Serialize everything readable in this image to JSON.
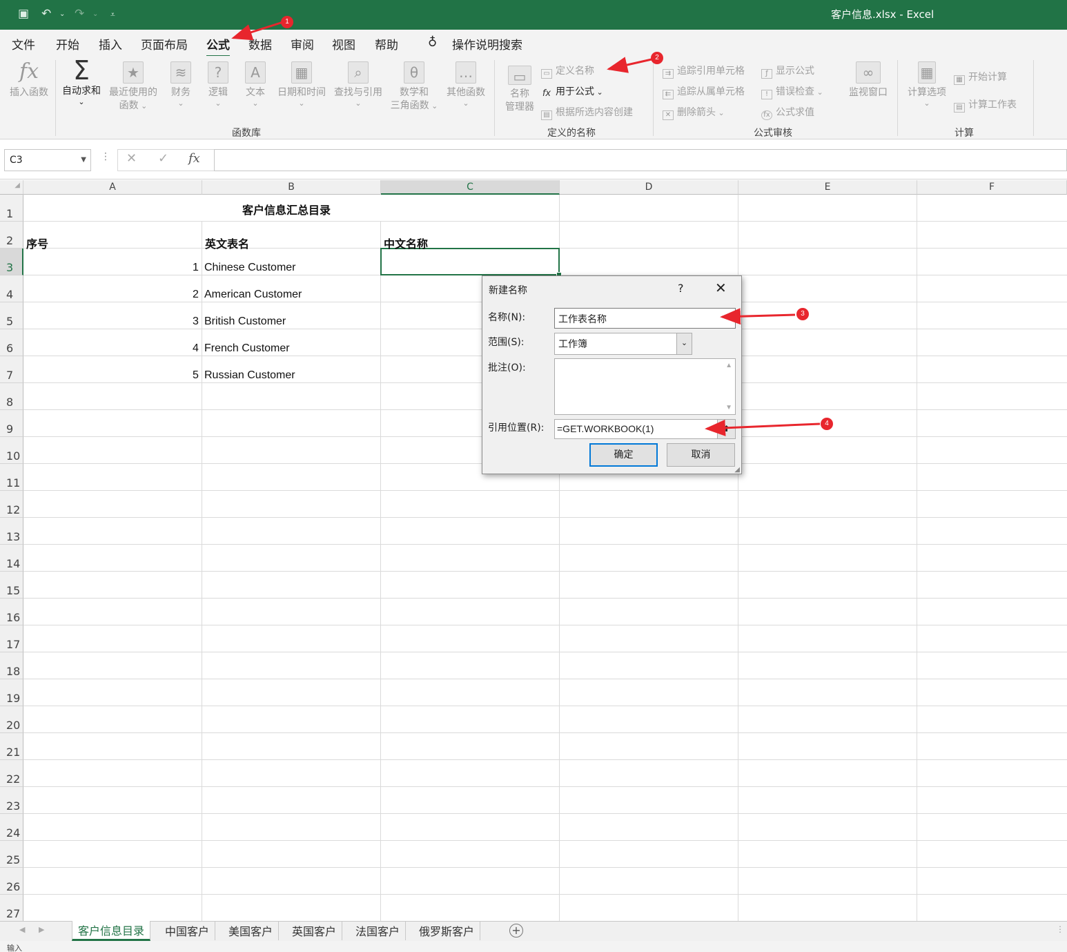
{
  "titlebar": {
    "title": "客户信息.xlsx  -  Excel"
  },
  "menu": [
    "文件",
    "开始",
    "插入",
    "页面布局",
    "公式",
    "数据",
    "审阅",
    "视图",
    "帮助"
  ],
  "tellme": "操作说明搜索",
  "ribbon": {
    "insert_function": "插入函数",
    "autosum": "自动求和",
    "recent": [
      "最近使用的",
      "函数"
    ],
    "financial": "财务",
    "logical": "逻辑",
    "text": "文本",
    "datetime": "日期和时间",
    "lookup": "查找与引用",
    "math": [
      "数学和",
      "三角函数"
    ],
    "more": "其他函数",
    "group_library": "函数库",
    "name_manager": [
      "名称",
      "管理器"
    ],
    "define_name": "定义名称",
    "use_in_formula": "用于公式",
    "create_from_selection": "根据所选内容创建",
    "group_defined_names": "定义的名称",
    "trace_precedents": "追踪引用单元格",
    "trace_dependents": "追踪从属单元格",
    "remove_arrows": "删除箭头",
    "show_formulas": "显示公式",
    "error_checking": "错误检查",
    "evaluate_formula": "公式求值",
    "watch_window": "监视窗口",
    "group_auditing": "公式审核",
    "calc_options": "计算选项",
    "calc_now": "开始计算",
    "calc_sheet": "计算工作表",
    "group_calc": "计算"
  },
  "formula_bar": {
    "name_box": "C3",
    "formula": ""
  },
  "columns": [
    "A",
    "B",
    "C",
    "D",
    "E",
    "F"
  ],
  "rows": [
    "1",
    "2",
    "3",
    "4",
    "5",
    "6",
    "7",
    "8",
    "9",
    "10",
    "11",
    "12",
    "13",
    "14",
    "15",
    "16",
    "17",
    "18",
    "19",
    "20",
    "21",
    "22",
    "23",
    "24",
    "25",
    "26",
    "27"
  ],
  "sheet": {
    "title": "客户信息汇总目录",
    "headers": [
      "序号",
      "英文表名",
      "中文名称"
    ],
    "data": [
      {
        "n": "1",
        "name": "Chinese Customer"
      },
      {
        "n": "2",
        "name": "American Customer"
      },
      {
        "n": "3",
        "name": "British Customer"
      },
      {
        "n": "4",
        "name": "French Customer"
      },
      {
        "n": "5",
        "name": "Russian Customer"
      }
    ]
  },
  "dialog": {
    "title": "新建名称",
    "help": "?",
    "close": "✕",
    "name_label": "名称(N):",
    "name_value": "工作表名称",
    "scope_label": "范围(S):",
    "scope_value": "工作簿",
    "comment_label": "批注(O):",
    "refers_label": "引用位置(R):",
    "refers_value": "=GET.WORKBOOK(1)",
    "ok": "确定",
    "cancel": "取消"
  },
  "tabs": [
    "客户信息目录",
    "中国客户",
    "美国客户",
    "英国客户",
    "法国客户",
    "俄罗斯客户"
  ],
  "status": "输入",
  "annotations": [
    "1",
    "2",
    "3",
    "4"
  ],
  "colors": {
    "accent": "#217346",
    "annotation": "#e8262d",
    "dialog_default": "#0078d7"
  }
}
